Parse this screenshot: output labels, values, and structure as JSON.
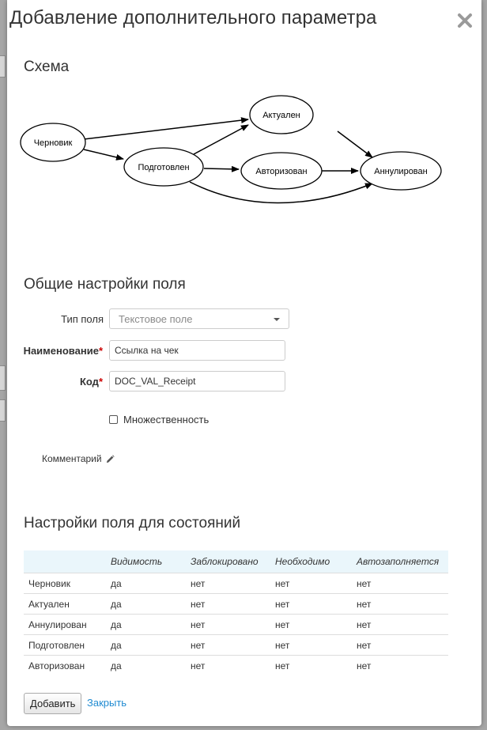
{
  "dialog": {
    "title": "Добавление дополнительного параметра",
    "close_icon": "close-icon"
  },
  "schema": {
    "title": "Схема",
    "nodes": {
      "draft": "Черновик",
      "prepared": "Подготовлен",
      "actual": "Актуален",
      "authorized": "Авторизован",
      "cancelled": "Аннулирован"
    }
  },
  "general": {
    "title": "Общие настройки поля",
    "field_type_label": "Тип поля",
    "field_type_value": "Текстовое поле",
    "name_label": "Наименование",
    "name_value": "Ссылка на чек",
    "code_label": "Код",
    "code_value": "DOC_VAL_Receipt",
    "required_mark": "*",
    "multiplicity_label": "Множественность",
    "multiplicity_checked": false,
    "comment_label": "Комментарий",
    "comment_icon": "pencil-icon"
  },
  "states": {
    "title": "Настройки поля для состояний",
    "columns": [
      "",
      "Видимость",
      "Заблокировано",
      "Необходимо",
      "Автозаполняется"
    ],
    "rows": [
      [
        "Черновик",
        "да",
        "нет",
        "нет",
        "нет"
      ],
      [
        "Актуален",
        "да",
        "нет",
        "нет",
        "нет"
      ],
      [
        "Аннулирован",
        "да",
        "нет",
        "нет",
        "нет"
      ],
      [
        "Подготовлен",
        "да",
        "нет",
        "нет",
        "нет"
      ],
      [
        "Авторизован",
        "да",
        "нет",
        "нет",
        "нет"
      ]
    ]
  },
  "footer": {
    "add_label": "Добавить",
    "close_label": "Закрыть"
  },
  "colors": {
    "link": "#1f8ad1",
    "required": "#cc0000",
    "table_header_bg": "#eaf6fb"
  }
}
